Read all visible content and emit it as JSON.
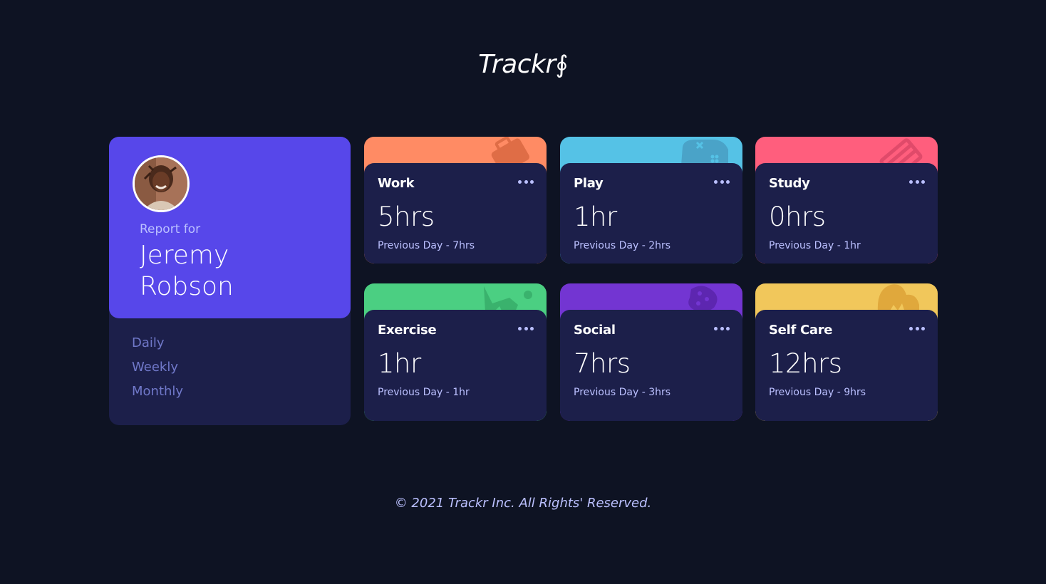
{
  "header": {
    "logo_text": "Trackr",
    "logo_glyph": "∮"
  },
  "profile": {
    "report_label": "Report for",
    "name": "Jeremy Robson",
    "periods": [
      "Daily",
      "Weekly",
      "Monthly"
    ]
  },
  "cards": [
    {
      "title": "Work",
      "hours": "5hrs",
      "previous": "Previous Day - 7hrs",
      "color": "#ff8b64",
      "icon": "briefcase-icon"
    },
    {
      "title": "Play",
      "hours": "1hr",
      "previous": "Previous Day - 2hrs",
      "color": "#55c2e6",
      "icon": "gamepad-icon"
    },
    {
      "title": "Study",
      "hours": "0hrs",
      "previous": "Previous Day - 1hr",
      "color": "#ff5e7d",
      "icon": "book-icon"
    },
    {
      "title": "Exercise",
      "hours": "1hr",
      "previous": "Previous Day - 1hr",
      "color": "#4bcf82",
      "icon": "runner-icon"
    },
    {
      "title": "Social",
      "hours": "7hrs",
      "previous": "Previous Day - 3hrs",
      "color": "#7335d2",
      "icon": "social-icon"
    },
    {
      "title": "Self Care",
      "hours": "12hrs",
      "previous": "Previous Day - 9hrs",
      "color": "#f1c75b",
      "icon": "self-care-icon"
    }
  ],
  "footer": {
    "text": "© 2021 Trackr Inc. All Rights' Reserved."
  }
}
